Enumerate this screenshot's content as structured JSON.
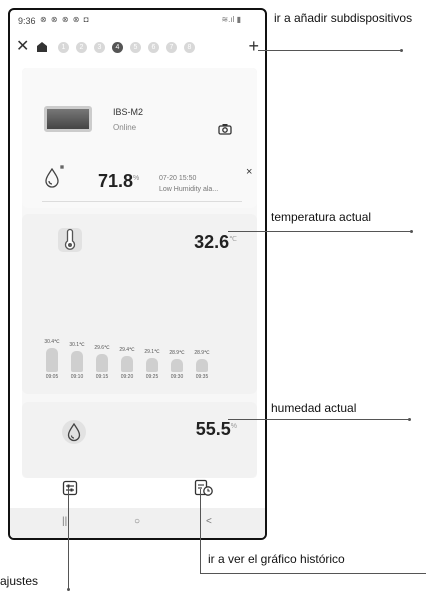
{
  "status_bar": {
    "time": "9:36",
    "icons": "⊗ ⊗ ⊗ ⊗ ◘",
    "signal": "≋.ıl ▮"
  },
  "tabs": {
    "close_icon": "close-icon",
    "home_icon": "home-icon",
    "numbers": [
      "1",
      "2",
      "3",
      "4",
      "5",
      "6",
      "7",
      "8"
    ],
    "active_index": 3,
    "add_icon": "plus-icon"
  },
  "device": {
    "name": "IBS-M2",
    "status": "Online"
  },
  "alarm": {
    "value": "71.8",
    "unit": "%",
    "time": "07-20 15:50",
    "message": "Low Humidity ala...",
    "close": "×"
  },
  "temperature": {
    "value": "32.6",
    "unit": "℃"
  },
  "chart_data": {
    "type": "bar",
    "categories": [
      "09:05",
      "09:10",
      "09:15",
      "09:20",
      "09:25",
      "09:30",
      "09:35"
    ],
    "labels": [
      "30.4℃",
      "30.1℃",
      "29.6℃",
      "29.4℃",
      "29.1℃",
      "28.9℃",
      "28.9℃"
    ],
    "values": [
      30.4,
      30.1,
      29.6,
      29.4,
      29.1,
      28.9,
      28.9
    ],
    "ylim": [
      28,
      31
    ]
  },
  "humidity": {
    "value": "55.5",
    "unit": "%"
  },
  "bottom_nav": {
    "back": "<",
    "home": "○",
    "recents": "|||"
  },
  "callouts": {
    "add_subdevices": "ir a añadir subdispositivos",
    "current_temperature": "temperatura actual",
    "current_humidity": "humedad actual",
    "history_chart": "ir a ver el gráfico histórico",
    "settings": "ajustes"
  }
}
